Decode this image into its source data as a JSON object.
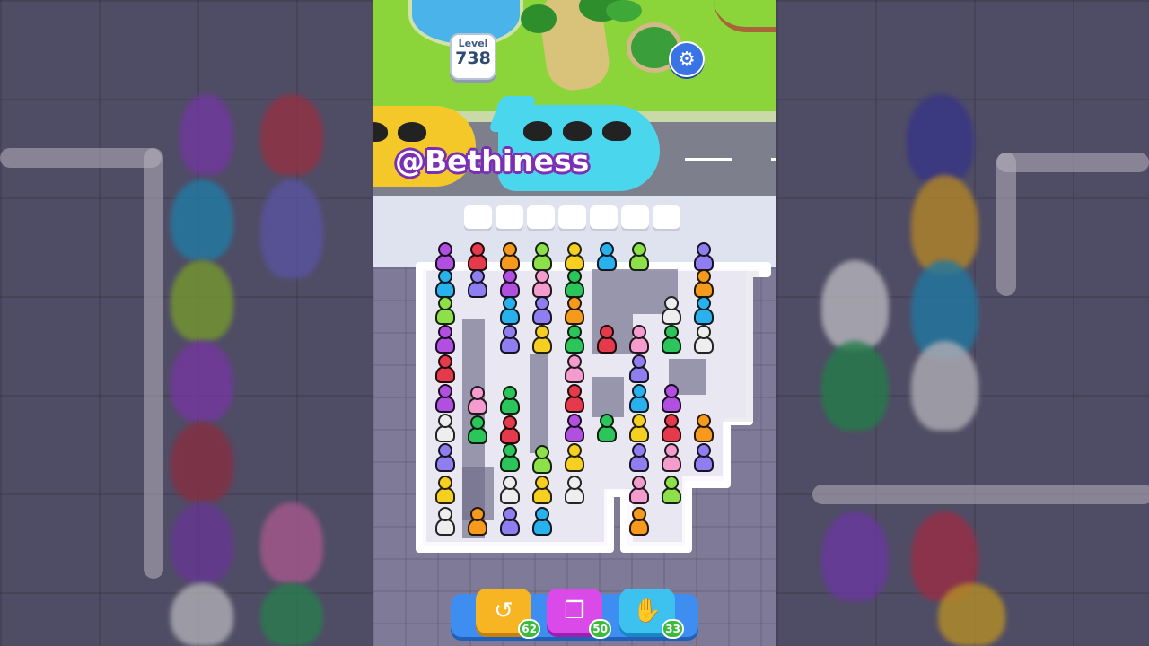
{
  "watermark": "@Bethiness",
  "level": {
    "label": "Level",
    "number": "738"
  },
  "settings_icon": "gear-icon",
  "seat_slots": 7,
  "tools": [
    {
      "name": "undo",
      "icon": "undo-icon",
      "count": "62",
      "color": "#f7b524"
    },
    {
      "name": "shuffle",
      "icon": "shuffle-icon",
      "count": "50",
      "color": "#d94ae8"
    },
    {
      "name": "helper",
      "icon": "hand-icon",
      "count": "33",
      "color": "#3dc1ee"
    }
  ],
  "colors": {
    "purple": "#b14fe0",
    "red": "#e43a4b",
    "orange": "#f59a1c",
    "lime": "#8de04a",
    "yellow": "#f5d020",
    "blue": "#29b1ee",
    "violet": "#8f7ef0",
    "pink": "#f39ccd",
    "green": "#2cc55c",
    "white": "#eeeeee"
  },
  "people": [
    [
      "purple",
      "blue",
      "lime",
      "purple",
      "red",
      "violet",
      "white",
      "violet",
      "yellow",
      "white"
    ],
    [
      "red",
      "violet",
      "pink",
      "green"
    ],
    [
      "yellow",
      "purple",
      "blue",
      "yellow"
    ],
    [
      "lime",
      "pink",
      "violet",
      "yellow"
    ],
    [
      "yellow",
      "green",
      "orange",
      "green",
      "pink",
      "red"
    ],
    [
      "blue",
      "green"
    ],
    [
      "lime"
    ],
    [
      "violet",
      "orange",
      "blue",
      "white"
    ]
  ]
}
